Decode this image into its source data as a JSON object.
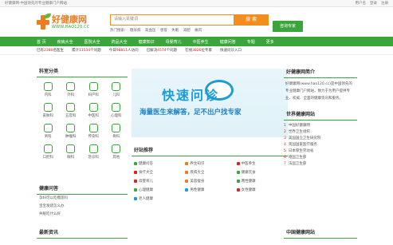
{
  "topbar": {
    "left": "好健康网·中国领先的专业健康门户网站",
    "right": [
      "用户名",
      "登录",
      "注册"
    ]
  },
  "logo": {
    "name": "好健康网",
    "url": "WWW.HAO120.CC"
  },
  "search": {
    "placeholder": "请输入关键词",
    "button": "搜 索"
  },
  "hot_words": [
    "热门搜索:",
    "糖尿病",
    "高血压",
    "感冒",
    "失眠",
    "减肥",
    "痛风"
  ],
  "green_button": "咨询专家",
  "nav": [
    "首 页",
    "疾病大全",
    "医院大全",
    "药品大全",
    "健康知识",
    "母婴育儿",
    "中医养生",
    "健康问答",
    "专题",
    "更多"
  ],
  "ticker": [
    {
      "pre": "已有",
      "num": "2380",
      "post": "名医生"
    },
    {
      "pre": "累计",
      "num": "11534",
      "post": "个问题"
    },
    {
      "pre": "今日",
      "num": "98811",
      "post": "人访问"
    },
    {
      "pre": "已解决",
      "num": "4574",
      "post": "个问题"
    },
    {
      "pre": "在线",
      "num": "3826",
      "post": "位专家"
    },
    {
      "pre": "",
      "num": "",
      "post": "快速问诊入口"
    }
  ],
  "category": {
    "title": "科室分类",
    "items": [
      "内科",
      "外科",
      "妇产科",
      "儿科",
      "皮肤科",
      "五官科",
      "中医科",
      "心理科",
      "男科",
      "肿瘤科",
      "传染科",
      "骨科",
      "口腔科",
      "眼科",
      "急诊科",
      "其他"
    ]
  },
  "banner": {
    "title": "快速问诊",
    "sub": "海量医生来解答，足不出户找专家"
  },
  "recommend": {
    "title": "好站推荐",
    "items": [
      "健康问答",
      "养生知识",
      "中医养生",
      "食疗大全",
      "疾病大全",
      "健康饮食",
      "母婴育儿",
      "美容瘦身",
      "两性健康",
      "心理健康",
      "男性健康",
      "女性健康",
      "老人健康"
    ]
  },
  "about": {
    "title": "好健康网简介",
    "text": "好健康网(www.hao120.cc)是中国领先的专业健康门户网站，致力于为用户提供专业、权威、全面的健康资讯和服务。"
  },
  "ranking": {
    "title": "世界健康网站",
    "items": [
      "中国好健康网",
      "世界卫生组织",
      "美国国立卫生研究院",
      "英国国家医疗服务",
      "日本厚生劳动省",
      "德国卫生部",
      "法国卫生部"
    ]
  },
  "health_qa": {
    "title": "健康问答",
    "items": [
      "孕妇可以吃榴莲吗",
      "宝宝发烧怎么办",
      "失眠吃什么好"
    ]
  },
  "newest": {
    "title": "最新资讯"
  },
  "cn_net": {
    "title": "中国健康网站"
  }
}
